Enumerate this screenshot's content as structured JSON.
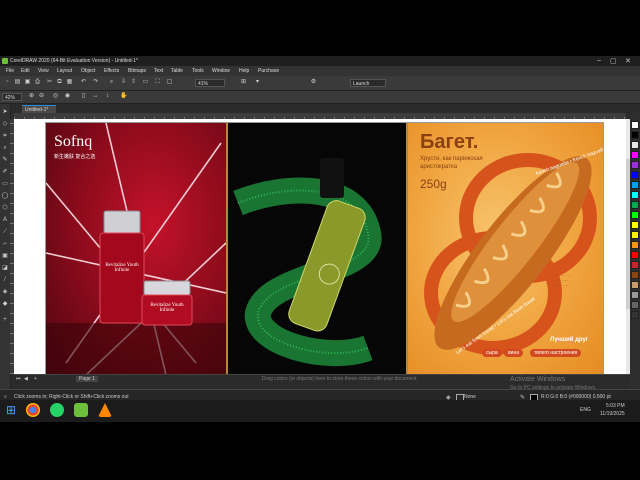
{
  "window": {
    "title": "CorelDRAW 2020 (64-Bit Evaluation Version) - Untitled-1*",
    "controls": [
      "minimize-icon",
      "maximize-icon",
      "close-icon"
    ]
  },
  "menu": [
    "File",
    "Edit",
    "View",
    "Layout",
    "Object",
    "Effects",
    "Bitmaps",
    "Text",
    "Table",
    "Tools",
    "Window",
    "Help",
    "Purchase"
  ],
  "toolbar": {
    "zoom_value": "41%",
    "launch_label": "Launch"
  },
  "property_bar": {
    "zoom_value": "42%"
  },
  "document_tab": "Untitled-1*",
  "page_tab": "Page 1",
  "hint_text": "Drag colors (or objects) here to store these colors with your document",
  "activate": {
    "line1": "Activate Windows",
    "line2": "Go to PC settings to activate Windows."
  },
  "status": {
    "hint": "Click zooms in; Right-Click or Shift+Click zooms out",
    "fill": "None",
    "outline": "R:0 G:0 B:0 (#000000)  0.500 pt"
  },
  "artwork": {
    "brand": "Sofnq",
    "brand_cn": "新生嫩肤 复合之选",
    "bottle_tall_label": "Revitalize Youth Infinite",
    "bottle_small_label": "Revitalize Youth Infinite",
    "ru_title": "Багет.",
    "ru_subtitle": "Хрусти, как парижская аристократка",
    "ru_weight": "250g",
    "ring_text_outer": "french baguette • french baguette • french bread",
    "ring_text_inner": "Let's eat fresh bread • Let's eat fresh bread",
    "lucky": "Лучший друг",
    "pills": [
      "сыра",
      "вина",
      "твоего настроения"
    ]
  },
  "taskbar": {
    "lang": "ENG",
    "time": "5:03 PM",
    "date": "11/19/2025"
  },
  "colors": {
    "accent": "#2a8fd9",
    "palette": [
      "#ffffff",
      "#000000",
      "#e6e6e6",
      "#ff00ff",
      "#9b30d9",
      "#0000ff",
      "#00a0e9",
      "#00ffff",
      "#00a651",
      "#00ff00",
      "#ffff00",
      "#fff200",
      "#f7941d",
      "#ff0000",
      "#c1272d",
      "#8b4513",
      "#c69c6d",
      "#999999",
      "#666666",
      "#333333"
    ]
  }
}
